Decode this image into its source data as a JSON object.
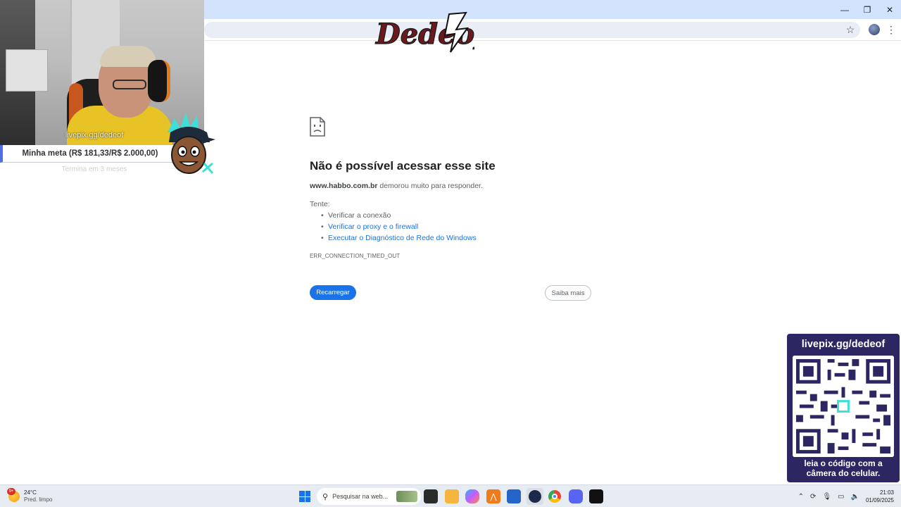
{
  "browser": {
    "window_controls": {
      "minimize": "—",
      "restore": "❐",
      "close": "✕"
    },
    "toolbar_icons": [
      "bookmark-star-icon",
      "profile-avatar-icon",
      "menu-kebab-icon"
    ]
  },
  "error_page": {
    "title": "Não é possível acessar esse site",
    "host": "www.habbo.com.br",
    "description": " demorou muito para responder.",
    "try_label": "Tente:",
    "suggestions": [
      {
        "text": "Verificar a conexão",
        "link": false
      },
      {
        "text": "Verificar o proxy e o firewall",
        "link": true
      },
      {
        "text": "Executar o Diagnóstico de Rede do Windows",
        "link": true
      }
    ],
    "error_code": "ERR_CONNECTION_TIMED_OUT",
    "reload_button": "Recarregar",
    "more_button": "Saiba mais"
  },
  "overlay": {
    "logo_text": "Dedeof",
    "webcam_url": "livepix.gg/dedeof",
    "goal": "Minha meta (R$ 181,33/R$ 2.000,00)",
    "goal_sub": "Termina em 3 meses",
    "qr": {
      "title": "livepix.gg/dedeof",
      "footer_line1": "leia o código com a",
      "footer_line2": "câmera do celular."
    }
  },
  "taskbar": {
    "weather_temp": "24°C",
    "weather_desc": "Pred. limpo",
    "weather_badge": "9+",
    "search_placeholder": "Pesquisar na web...",
    "apps": [
      "start-icon",
      "task-view-icon",
      "file-explorer-icon",
      "copilot-icon",
      "app-orange-icon",
      "store-icon",
      "steam-icon",
      "chrome-icon",
      "discord-icon",
      "capcut-icon"
    ],
    "clock_time": "21:03",
    "clock_date": "01/09/2025"
  },
  "colors": {
    "accent": "#1a73e8",
    "titlebar": "#d3e3fd",
    "qr_bg": "#2c2663",
    "goal_accent": "#4f6fe0"
  }
}
